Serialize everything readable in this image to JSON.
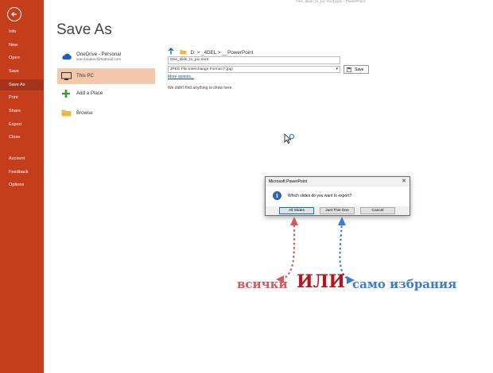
{
  "window": {
    "title": "One_slide_to_pic-rev3.pptx  -  PowerPoint"
  },
  "sidebar": {
    "back_icon": "arrow-left-circle-icon",
    "items": [
      {
        "label": "Info"
      },
      {
        "label": "New"
      },
      {
        "label": "Open"
      },
      {
        "label": "Save"
      },
      {
        "label": "Save As",
        "selected": true
      },
      {
        "label": "Print"
      },
      {
        "label": "Share"
      },
      {
        "label": "Export"
      },
      {
        "label": "Close"
      },
      {
        "label": "Account"
      },
      {
        "label": "Feedback"
      },
      {
        "label": "Options"
      }
    ]
  },
  "page": {
    "title": "Save As"
  },
  "locations": [
    {
      "label": "OneDrive - Personal",
      "sublabel": "ivan.boukev@hotmail.com",
      "icon": "cloud-icon"
    },
    {
      "label": "This PC",
      "icon": "pc-icon",
      "selected": true
    },
    {
      "label": "Add a Place",
      "icon": "plus-icon"
    },
    {
      "label": "Browse",
      "icon": "folder-icon"
    }
  ],
  "save_panel": {
    "breadcrumb": "D: > _4DEL > __PowerPoint",
    "filename": "One_slide_to_pic-rev3",
    "filetype": "JPEG File Interchange Format (*.jpg)",
    "save_label": "Save",
    "more_options": "More options...",
    "empty_message": "We didn't find anything to show here."
  },
  "dialog": {
    "title": "Microsoft PowerPoint",
    "close": "✕",
    "question": "Which slides do you want to export?",
    "buttons": {
      "all": "All Slides",
      "this": "Just This One",
      "cancel": "Cancel"
    }
  },
  "annotations": {
    "left": "всички",
    "middle": "ИЛИ",
    "right": "само избрания",
    "colors": {
      "left": "#d9575f",
      "middle": "#b3161d",
      "right": "#3b7bd0"
    }
  },
  "colors": {
    "sidebar": "#c43e1c",
    "selected_location": "#f4c8aa"
  }
}
